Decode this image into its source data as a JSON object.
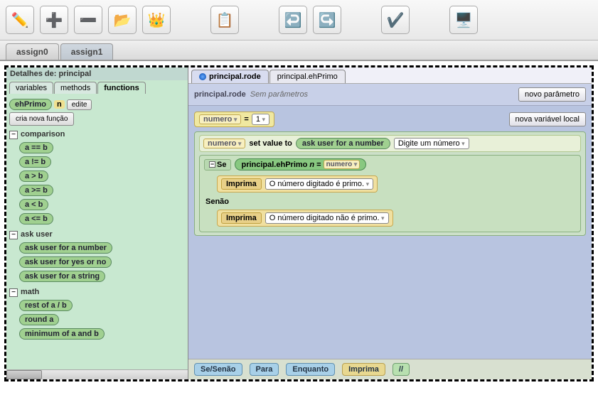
{
  "toolbar_icons": [
    "✏️",
    "➕",
    "➖",
    "📂",
    "👑",
    "",
    "📋",
    "",
    "↩️",
    "↪️",
    "",
    "✔️",
    "",
    "🖥️"
  ],
  "doc_tabs": [
    "assign0",
    "assign1"
  ],
  "sidebar": {
    "title": "Detalhes de: principal",
    "tabs": [
      "variables",
      "methods",
      "functions"
    ],
    "fn_name": "ehPrimo",
    "fn_param": "n",
    "edit": "edite",
    "new_fn": "cria nova função",
    "cats": [
      {
        "name": "comparison",
        "items": [
          "a == b",
          "a != b",
          "a > b",
          "a >= b",
          "a < b",
          "a <= b"
        ]
      },
      {
        "name": "ask user",
        "items": [
          "ask user for a number",
          "ask user for yes or no",
          "ask user for a string"
        ]
      },
      {
        "name": "math",
        "items": [
          "rest of a / b",
          "round a",
          "minimum of a and b"
        ]
      }
    ]
  },
  "editor": {
    "tabs": [
      "principal.rode",
      "principal.ehPrimo"
    ],
    "file": "principal.rode",
    "sub": "Sem parâmetros",
    "new_param": "novo parâmetro",
    "var_name": "numero",
    "var_eq": "=",
    "var_val": "1",
    "new_var": "nova variável local",
    "set_var": "numero",
    "set_kw": "set value to",
    "ask": "ask user for a number",
    "prompt": "Digite um número",
    "if_kw": "Se",
    "call": "principal.ehPrimo",
    "call_p": "n",
    "call_eq": "=",
    "call_arg": "numero",
    "print": "Imprima",
    "msg1": "O número digitado é primo.",
    "else_kw": "Senão",
    "msg2": "O número digitado não é primo.",
    "footer": [
      "Se/Senão",
      "Para",
      "Enquanto",
      "Imprima",
      "//"
    ]
  }
}
